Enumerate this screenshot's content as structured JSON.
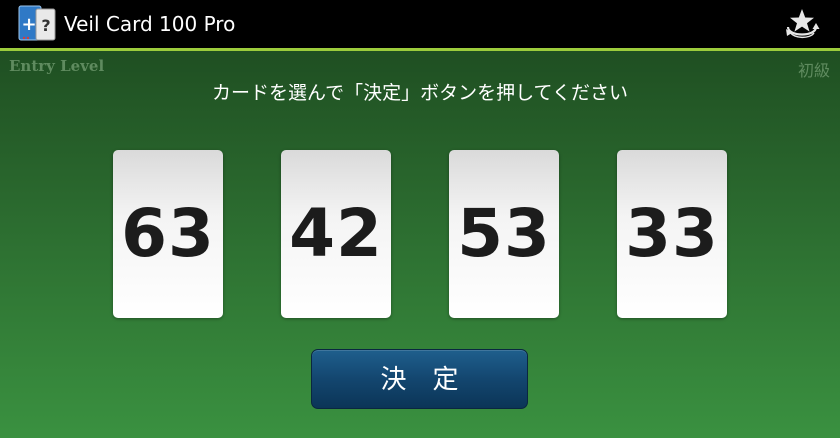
{
  "app_bar": {
    "icon": "veil-card-app-icon",
    "icon_plus": "+",
    "icon_question": "?",
    "title": "Veil Card 100 Pro",
    "action_icon": "star-rotate-icon"
  },
  "level": {
    "english": "Entry Level",
    "japanese": "初級"
  },
  "instruction": "カードを選んで「決定」ボタンを押してください",
  "cards": [
    "63",
    "42",
    "53",
    "33"
  ],
  "decide_button": {
    "label": "決定"
  },
  "colors": {
    "top_bar": "#000000",
    "accent_line": "#9ccc3c",
    "background_top": "#1f4f22",
    "background_bottom": "#3a9140",
    "button": "#13466f"
  }
}
